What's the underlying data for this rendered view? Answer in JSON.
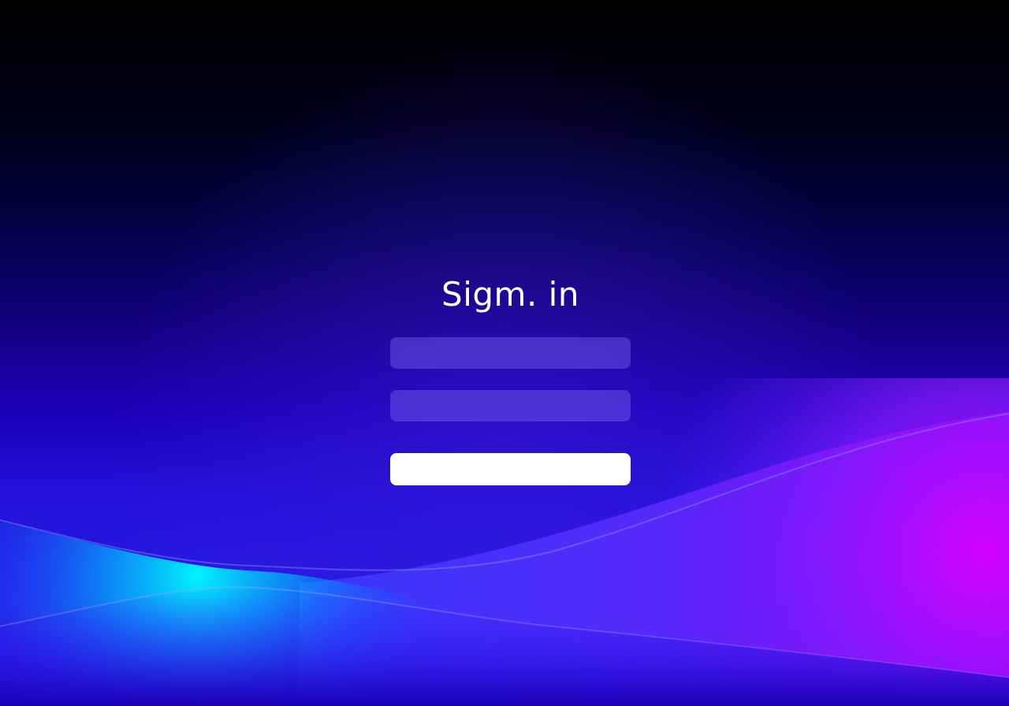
{
  "page": {
    "title": "Sigm.  in"
  },
  "form": {
    "username_placeholder": "",
    "username_value": "",
    "password_placeholder": "",
    "password_value": "",
    "submit_label": ""
  },
  "colors": {
    "background_top": "#000000",
    "background_mid": "#11007a",
    "background_bottom": "#2410d9",
    "wave_cyan": "#00f0ff",
    "wave_magenta": "#c800ff",
    "field_fill": "#4a2cc8",
    "button_fill": "#ffffff",
    "title_color": "#ffffff"
  }
}
